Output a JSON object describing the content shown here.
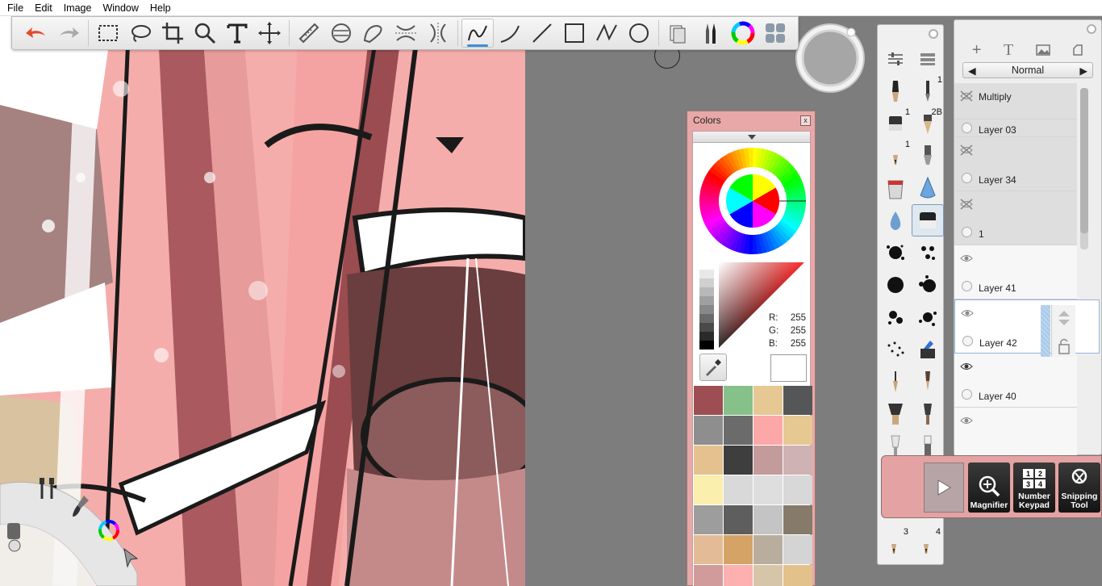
{
  "menu": [
    "File",
    "Edit",
    "Image",
    "Window",
    "Help"
  ],
  "toolbar": {
    "tools": [
      "undo",
      "redo",
      "rect-select",
      "lasso",
      "crop",
      "magnify",
      "text",
      "transform",
      "ruler",
      "ellipse-guide",
      "french-curve",
      "symmetry-x",
      "symmetry-y",
      "freehand-stroke",
      "curve-stroke",
      "line",
      "rectangle",
      "polyline",
      "ellipse",
      "copic-library",
      "brush-library",
      "color-editor",
      "extras"
    ]
  },
  "colors_panel": {
    "title": "Colors",
    "close": "x",
    "r_label": "R:",
    "g_label": "G:",
    "b_label": "B:",
    "r": "255",
    "g": "255",
    "b": "255",
    "current": "#ffffff",
    "swatches": [
      "#9d4e53",
      "#86c189",
      "#e6c892",
      "#555657",
      "#8e8e8e",
      "#6b6b6b",
      "#fca7a8",
      "#e6c892",
      "#e5c18f",
      "#3e3e3e",
      "#c39b9b",
      "#cfb2b3",
      "#fbefae",
      "#d9d9d9",
      "#dedede",
      "#d8d8d8",
      "#9d9d9d",
      "#5e5e5e",
      "#c4c4c4",
      "#867b6b",
      "#e3bc97",
      "#d4a365",
      "#b9ad9e",
      "#d4d4d4",
      "#d09b9a",
      "#fdb0b0",
      "#d6c5a8",
      "#e3c18b"
    ]
  },
  "brush_panel": {
    "numbers": [
      "1",
      "1",
      "2B",
      "1",
      "3",
      "4"
    ]
  },
  "layers_panel": {
    "blend_mode": "Normal",
    "layers": [
      {
        "name": "Multiply",
        "visible": false
      },
      {
        "name": "Layer 03",
        "visible": true
      },
      {
        "name": "Layer 34",
        "visible": false
      },
      {
        "name": "1",
        "visible": false
      },
      {
        "name": "Layer 41",
        "visible": true
      },
      {
        "name": "Layer 42",
        "visible": true
      },
      {
        "name": "Layer 40",
        "visible": true
      }
    ]
  },
  "float_panel": {
    "magnifier": "Magnifier",
    "keypad_line1": "Number",
    "keypad_line2": "Keypad",
    "snip_line1": "Snipping",
    "snip_line2": "Tool",
    "keys": [
      "1",
      "2",
      "3",
      "4"
    ]
  }
}
